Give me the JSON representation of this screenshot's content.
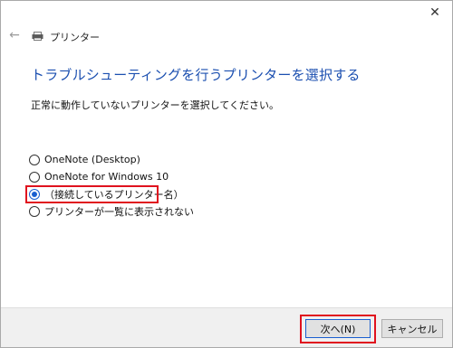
{
  "window": {
    "title": "プリンター",
    "close_glyph": "✕",
    "back_glyph": "←"
  },
  "heading": "トラブルシューティングを行うプリンターを選択する",
  "instruction": "正常に動作していないプリンターを選択してください。",
  "printers": [
    {
      "label": "OneNote (Desktop)",
      "selected": false
    },
    {
      "label": "OneNote for Windows 10",
      "selected": false
    },
    {
      "label": "（接続しているプリンター名）",
      "selected": true
    },
    {
      "label": "プリンターが一覧に表示されない",
      "selected": false
    }
  ],
  "buttons": {
    "next": "次へ(N)",
    "cancel": "キャンセル"
  },
  "colors": {
    "heading": "#1b4fb0",
    "highlight": "#e0121e",
    "radio_accent": "#1a5fd0"
  },
  "icons": {
    "back": "back-arrow-icon",
    "printer": "printer-icon",
    "close": "close-icon"
  }
}
